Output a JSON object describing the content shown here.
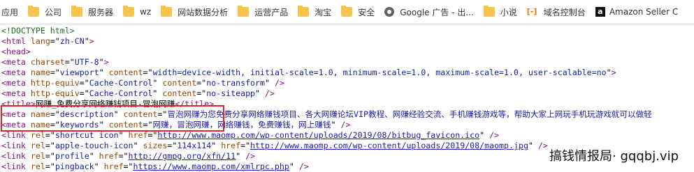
{
  "bookmarks": [
    {
      "label": "应用",
      "icon": "apps-icon"
    },
    {
      "label": "公司",
      "icon": "folder-icon"
    },
    {
      "label": "服务器",
      "icon": "folder-icon"
    },
    {
      "label": "wz",
      "icon": "folder-icon"
    },
    {
      "label": "网站数据分析",
      "icon": "folder-icon"
    },
    {
      "label": "运营产品",
      "icon": "folder-icon"
    },
    {
      "label": "淘宝",
      "icon": "folder-icon"
    },
    {
      "label": "安全",
      "icon": "folder-icon"
    },
    {
      "label": "Google 广告 - 出...",
      "icon": "google-icon"
    },
    {
      "label": "小说",
      "icon": "folder-icon"
    },
    {
      "label": "域名控制台",
      "icon": "aliyun-icon"
    },
    {
      "label": "Amazon Seller C",
      "icon": "amazon-icon"
    }
  ],
  "source": {
    "doctype": "<!DOCTYPE html>",
    "lang": "zh-CN",
    "charset": "UTF-8",
    "viewport_content": "width=device-width, initial-scale=1.0, minimum-scale=1.0, maximum-scale=1.0, user-scalable=no",
    "cache1_content": "no-transform",
    "cache2_content": "no-siteapp",
    "title": "网赚_免费分享网络赚钱项目-冒泡网赚",
    "description_content": "冒泡网赚为您免费分享网络赚钱项目、各大网赚论坛VIP教程、网赚经验交流、手机赚钱游戏等，帮助大家上网玩手机玩游戏就可以做轻",
    "keywords_content": "网赚，冒泡网赚，网络赚钱，免费赚钱，网上赚钱",
    "shortcut_href": "http://www.maomp.com/wp-content/uploads/2019/08/bitbug_favicon.ico",
    "apple_sizes": "114x114",
    "apple_href": "http://www.maomp.com/wp-content/uploads/2019/08/maomp.jpg",
    "profile_href": "http://gmpg.org/xfn/11",
    "pingback_href": "https://www.maomp.com/xmlrpc.php"
  },
  "watermark": "搞钱情报局· gqqbj.vip"
}
